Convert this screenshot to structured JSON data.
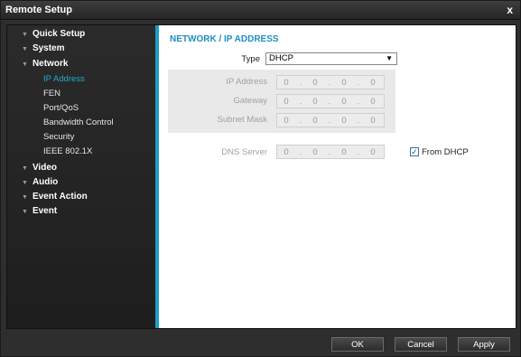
{
  "window": {
    "title": "Remote Setup",
    "close_label": "x"
  },
  "sidebar": {
    "items": [
      {
        "label": "Quick Setup"
      },
      {
        "label": "System"
      },
      {
        "label": "Network"
      },
      {
        "label": "Video"
      },
      {
        "label": "Audio"
      },
      {
        "label": "Event Action"
      },
      {
        "label": "Event"
      }
    ],
    "network_subitems": [
      {
        "label": "IP Address",
        "active": true
      },
      {
        "label": "FEN"
      },
      {
        "label": "Port/QoS"
      },
      {
        "label": "Bandwidth Control"
      },
      {
        "label": "Security"
      },
      {
        "label": "IEEE 802.1X"
      }
    ]
  },
  "content": {
    "section_title": "NETWORK / IP ADDRESS",
    "type_label": "Type",
    "type_value": "DHCP",
    "ip_address_label": "IP Address",
    "gateway_label": "Gateway",
    "subnet_mask_label": "Subnet Mask",
    "dns_server_label": "DNS Server",
    "ip_address": [
      "0",
      "0",
      "0",
      "0"
    ],
    "gateway": [
      "0",
      "0",
      "0",
      "0"
    ],
    "subnet_mask": [
      "0",
      "0",
      "0",
      "0"
    ],
    "dns_server": [
      "0",
      "0",
      "0",
      "0"
    ],
    "dot": ".",
    "from_dhcp_label": "From DHCP",
    "from_dhcp_checked": true
  },
  "footer": {
    "ok_label": "OK",
    "cancel_label": "Cancel",
    "apply_label": "Apply"
  },
  "colors": {
    "accent": "#1a9fc7",
    "active_item": "#27a7d4"
  }
}
